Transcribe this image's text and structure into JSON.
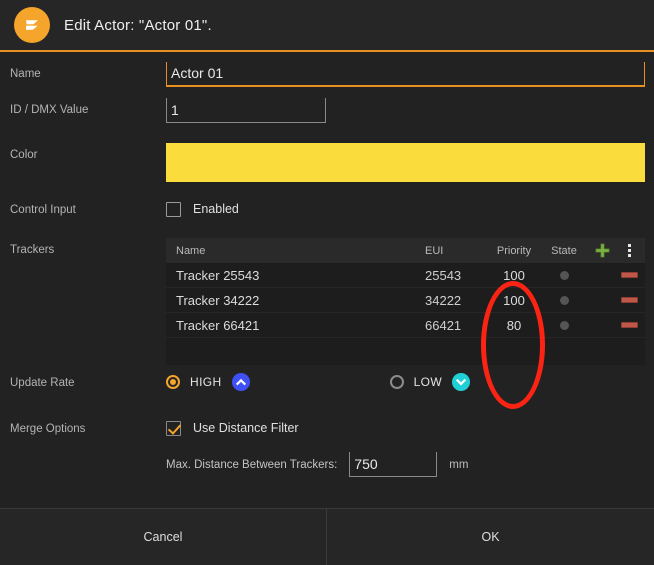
{
  "header": {
    "title": "Edit Actor: \"Actor 01\".",
    "logo_icon": "zactrack-z-logo-icon",
    "accent_color": "#e8901f"
  },
  "form": {
    "name": {
      "label": "Name",
      "value": "Actor 01",
      "placeholder": ""
    },
    "dmx": {
      "label": "ID / DMX Value",
      "value": "1",
      "placeholder": ""
    },
    "color": {
      "label": "Color",
      "value": "#fadc3c"
    },
    "control_input": {
      "label": "Control Input",
      "checkbox_label": "Enabled",
      "checked": false
    },
    "trackers": {
      "label": "Trackers",
      "columns": [
        "Name",
        "EUI",
        "Priority",
        "State"
      ],
      "add_icon": "plus-icon",
      "menu_icon": "overflow-menu-icon",
      "rows": [
        {
          "name": "Tracker 25543",
          "eui": "25543",
          "priority": "100",
          "state": "inactive",
          "remove_icon": "minus-icon"
        },
        {
          "name": "Tracker 34222",
          "eui": "34222",
          "priority": "100",
          "state": "inactive",
          "remove_icon": "minus-icon"
        },
        {
          "name": "Tracker 66421",
          "eui": "66421",
          "priority": "80",
          "state": "inactive",
          "remove_icon": "minus-icon"
        }
      ]
    },
    "update_rate": {
      "label": "Update Rate",
      "options": [
        {
          "label": "HIGH",
          "selected": true,
          "badge_icon": "chevron-up-icon",
          "badge_color": "#3f51f5"
        },
        {
          "label": "LOW",
          "selected": false,
          "badge_icon": "chevron-down-icon",
          "badge_color": "#21cfd6"
        }
      ]
    },
    "merge_options": {
      "label": "Merge Options",
      "checkbox_label": "Use Distance Filter",
      "checked": true,
      "distance_label": "Max. Distance Between Trackers:",
      "distance_value": "750",
      "distance_unit": "mm"
    }
  },
  "footer": {
    "cancel_label": "Cancel",
    "ok_label": "OK"
  },
  "annotation": {
    "shape": "ellipse",
    "color": "#fb2414",
    "targets": "priority-column"
  }
}
